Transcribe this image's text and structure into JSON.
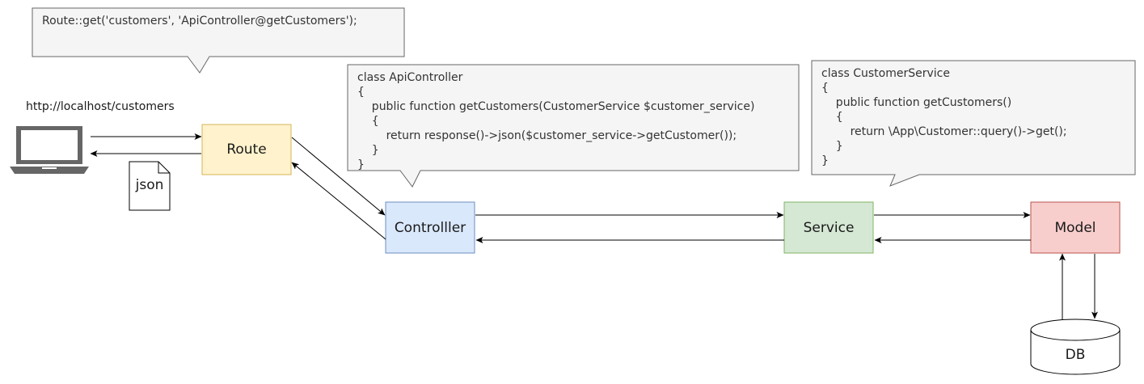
{
  "callouts": {
    "route_code": "Route::get('customers', 'ApiController@getCustomers');",
    "controller_code": "class ApiController\n{\n    public function getCustomers(CustomerService $customer_service)\n    {\n        return response()->json($customer_service->getCustomer());\n    }\n}",
    "service_code": "class CustomerService\n{\n    public function getCustomers()\n    {\n        return \\App\\Customer::query()->get();\n    }\n}"
  },
  "client": {
    "url": "http://localhost/customers",
    "icon": "laptop-icon"
  },
  "document": {
    "label": "json",
    "icon": "document-icon"
  },
  "nodes": {
    "route": "Route",
    "controller": "Controlller",
    "service": "Service",
    "model": "Model",
    "db": "DB"
  },
  "colors": {
    "route_fill": "#fff2cc",
    "route_stroke": "#d6b656",
    "controller_fill": "#dae8fc",
    "controller_stroke": "#6c8ebf",
    "service_fill": "#d5e8d4",
    "service_stroke": "#82b366",
    "model_fill": "#f8cecc",
    "model_stroke": "#b85450",
    "callout_fill": "#f5f5f5",
    "callout_stroke": "#666666",
    "arrow": "#000000"
  }
}
